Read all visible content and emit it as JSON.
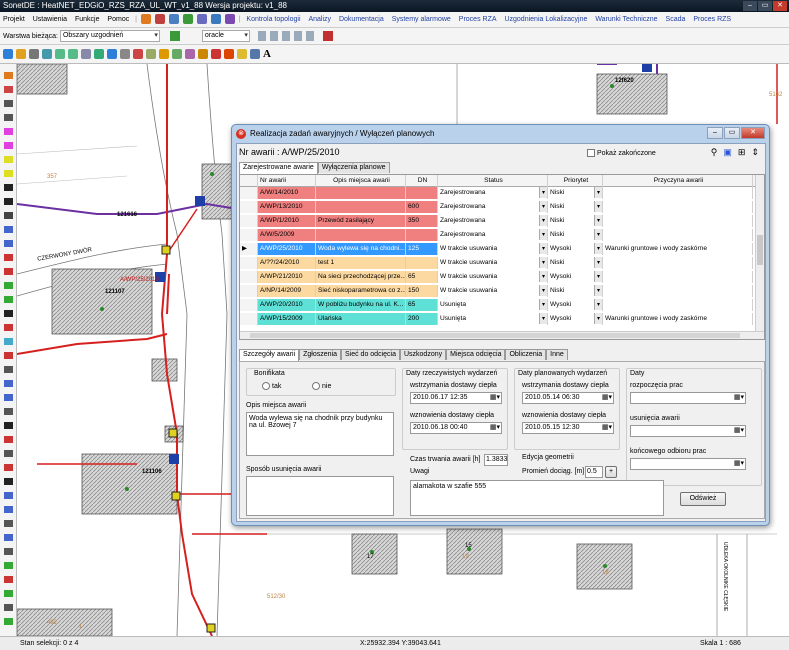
{
  "window": {
    "title": "SonetDE : HeatNET_EDGiO_RZS_RZA_UL_WT_v1_88  Wersja projektu: v1_88",
    "min": "‒",
    "max": "▭",
    "close": "✕"
  },
  "menu": {
    "items": [
      "Projekt",
      "Ustawienia",
      "Funkcje",
      "Pomoc"
    ],
    "blue_items": [
      "Kontrola topologii",
      "Analizy",
      "Dokumentacja",
      "Systemy alarmowe",
      "Proces RZA",
      "Uzgodnienia Lokalizacyjne",
      "Warunki Techniczne",
      "Scada",
      "Proces RZS"
    ]
  },
  "toolbar": {
    "version_label": "Warstwa bieżąca:",
    "version_value": "Obszary uzgodnień",
    "db_value": "oracle"
  },
  "map": {
    "labels": [
      "121616",
      "CZERWONY DWÓR",
      "A/WP/25/2010",
      "121107",
      "121106",
      "12f620",
      "357",
      "5162",
      "492",
      "1",
      "19",
      "15",
      "17",
      "18",
      "512/30",
      "UDŁEKA OKOLNIKE CŁĘSKIE"
    ]
  },
  "status": {
    "selection": "Stan selekcji: 0 z 4",
    "coords": "X:25932.394  Y:39043.641",
    "scale": "Skala 1 : 686"
  },
  "dialog": {
    "title": "Realizacja zadań awaryjnych / Wyłączeń planowych",
    "nr_label": "Nr awarii : A/WP/25/2010",
    "show_closed": "Pokaż zakończone",
    "tabs_top": [
      "Zarejestrowane awarie",
      "Wyłączenia planowe"
    ],
    "columns": [
      "Nr awarii",
      "Opis miejsca awarii",
      "DN",
      "Status",
      "Priorytet",
      "Przyczyna awarii"
    ],
    "rows": [
      {
        "nr": "A/W/14/2010",
        "opis": "",
        "dn": "",
        "status": "Zarejestrowana",
        "prio": "Niski",
        "przyczyna": "",
        "color": "#f08080"
      },
      {
        "nr": "A/WP/13/2010",
        "opis": "",
        "dn": "600",
        "status": "Zarejestrowana",
        "prio": "Niski",
        "przyczyna": "",
        "color": "#f08080"
      },
      {
        "nr": "A/WP/1/2010",
        "opis": "Przewód zasilający",
        "dn": "350",
        "status": "Zarejestrowana",
        "prio": "Niski",
        "przyczyna": "",
        "color": "#f08080"
      },
      {
        "nr": "A/W/5/2009",
        "opis": "",
        "dn": "",
        "status": "Zarejestrowana",
        "prio": "Niski",
        "przyczyna": "",
        "color": "#f08080"
      },
      {
        "nr": "A/WP/25/2010",
        "opis": "Woda wylewa się na chodni...",
        "dn": "125",
        "status": "W trakcie usuwania",
        "prio": "Wysoki",
        "przyczyna": "Warunki gruntowe i wody zaskórne",
        "color": "#3399ff",
        "selected": true
      },
      {
        "nr": "A/??/24/2010",
        "opis": "test 1",
        "dn": "",
        "status": "W trakcie usuwania",
        "prio": "Niski",
        "przyczyna": "",
        "color": "#fcd9a0"
      },
      {
        "nr": "A/WP/21/2010",
        "opis": "Na sieci przechodzącej prze...",
        "dn": "65",
        "status": "W trakcie usuwania",
        "prio": "Wysoki",
        "przyczyna": "",
        "color": "#fcd9a0"
      },
      {
        "nr": "A/NP/14/2009",
        "opis": "Sieć niskoparametrowa co z...",
        "dn": "150",
        "status": "W trakcie usuwania",
        "prio": "Niski",
        "przyczyna": "",
        "color": "#fcd9a0"
      },
      {
        "nr": "A/WP/20/2010",
        "opis": "W pobliżu budynku na ul. K...",
        "dn": "65",
        "status": "Usunięta",
        "prio": "Wysoki",
        "przyczyna": "",
        "color": "#5fe0d6"
      },
      {
        "nr": "A/WP/15/2009",
        "opis": "Ulańska",
        "dn": "200",
        "status": "Usunięta",
        "prio": "Wysoki",
        "przyczyna": "Warunki gruntowe i wody zaskórne",
        "color": "#5fe0d6"
      }
    ],
    "tabs_bottom": [
      "Szczegóły awarii",
      "Zgłoszenia",
      "Sieć do odcięcia",
      "Uszkodzony",
      "Miejsca odcięcia",
      "Obliczenia",
      "Inne"
    ],
    "bonifikata": "Bonifikata",
    "tak": "tak",
    "nie": "nie",
    "opis_label": "Opis miejsca awarii",
    "opis_text": "Woda wylewa się na chodnik przy budynku na ul. Bzowej 7",
    "sposob_label": "Sposób usunięcia awarii",
    "daty_rzecz": "Daty rzeczywistych wydarzeń",
    "wstrz_label": "wstrzymania dostawy ciepła",
    "wstrz_val": "2010.06.17  12:35",
    "wznow_label": "wznowienia dostawy ciepła",
    "wznow_val": "2010.06.18  00:40",
    "daty_plan": "Daty planowanych wydarzeń",
    "pwstrz_val": "2010.05.14  06:30",
    "pwznow_val": "2010.05.15  12:30",
    "daty": "Daty",
    "rozp_label": "rozpoczęcia prac",
    "usun_label": "usunięcia awarii",
    "konc_label": "końcowego odbioru prac",
    "czas_label": "Czas trwania awarii [h]",
    "czas_val": "1.3833",
    "edycja_label": "Edycja geometrii",
    "promien_label": "Promień dociąg. [m]",
    "promien_val": "0.5",
    "uwagi_label": "Uwagi",
    "uwagi_text": "alamakota w szafie 555",
    "odswiez": "Odśwież"
  }
}
